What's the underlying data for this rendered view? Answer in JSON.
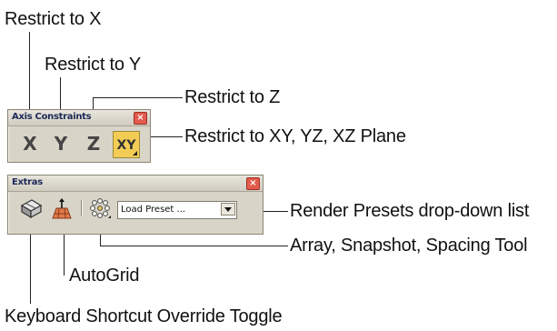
{
  "callouts": {
    "restrict_x": "Restrict to X",
    "restrict_y": "Restrict to Y",
    "restrict_z": "Restrict to Z",
    "restrict_plane": "Restrict to XY, YZ, XZ Plane",
    "render_presets": "Render Presets drop-down list",
    "array_tool": "Array, Snapshot, Spacing Tool",
    "autogrid": "AutoGrid",
    "keyboard_override": "Keyboard Shortcut Override Toggle"
  },
  "axis_panel": {
    "title": "Axis Constraints",
    "close": "×",
    "buttons": {
      "x": "X",
      "y": "Y",
      "z": "Z",
      "xy": "XY"
    }
  },
  "extras_panel": {
    "title": "Extras",
    "close": "×",
    "dropdown_value": "Load Preset ..."
  },
  "colors": {
    "active_button": "#f2cc55",
    "close_button": "#e25b4c",
    "panel_bg": "#d8d4c8"
  },
  "icons": {
    "keyboard_override": "keyboard-override-icon",
    "autogrid": "autogrid-icon",
    "array_tools": "array-flyout-icon"
  }
}
